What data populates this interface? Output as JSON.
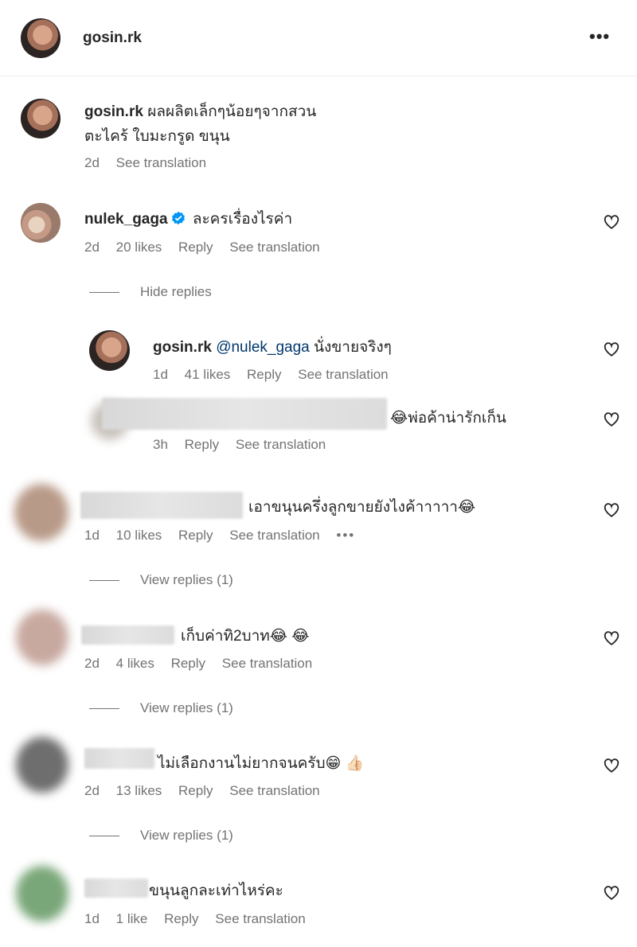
{
  "header": {
    "username": "gosin.rk"
  },
  "caption": {
    "username": "gosin.rk",
    "text_line1": "ผลผลิตเล็กๆน้อยๆจากสวน",
    "text_line2": "ตะไคร้ ใบมะกรูด ขนุน",
    "time": "2d",
    "see_translation": "See translation"
  },
  "comments": [
    {
      "username": "nulek_gaga",
      "text": "ละครเรื่องไรค่า",
      "time": "2d",
      "likes": "20 likes",
      "reply": "Reply",
      "see_translation": "See translation",
      "toggle": "Hide replies",
      "replies": [
        {
          "username": "gosin.rk",
          "mention": "@nulek_gaga",
          "text": "นั่งขายจริงๆ",
          "time": "1d",
          "likes": "41 likes",
          "reply": "Reply",
          "see_translation": "See translation"
        },
        {
          "text": "😂พ่อค้าน่ารักเก็น",
          "time": "3h",
          "reply": "Reply",
          "see_translation": "See translation"
        }
      ]
    },
    {
      "text": "เอาขนุนครึ่งลูกขายยังไงค้าาาาา😂",
      "time": "1d",
      "likes": "10 likes",
      "reply": "Reply",
      "see_translation": "See translation",
      "more": "•••",
      "toggle": "View replies (1)"
    },
    {
      "text": "เก็บค่าทิ2บาท😂 😂",
      "time": "2d",
      "likes": "4 likes",
      "reply": "Reply",
      "see_translation": "See translation",
      "toggle": "View replies (1)"
    },
    {
      "text": "ไม่เลือกงานไม่ยากจนครับ😁 👍🏻",
      "time": "2d",
      "likes": "13 likes",
      "reply": "Reply",
      "see_translation": "See translation",
      "toggle": "View replies (1)"
    },
    {
      "text": "ขนุนลูกละเท่าไหร่คะ",
      "time": "1d",
      "likes": "1 like",
      "reply": "Reply",
      "see_translation": "See translation"
    }
  ]
}
